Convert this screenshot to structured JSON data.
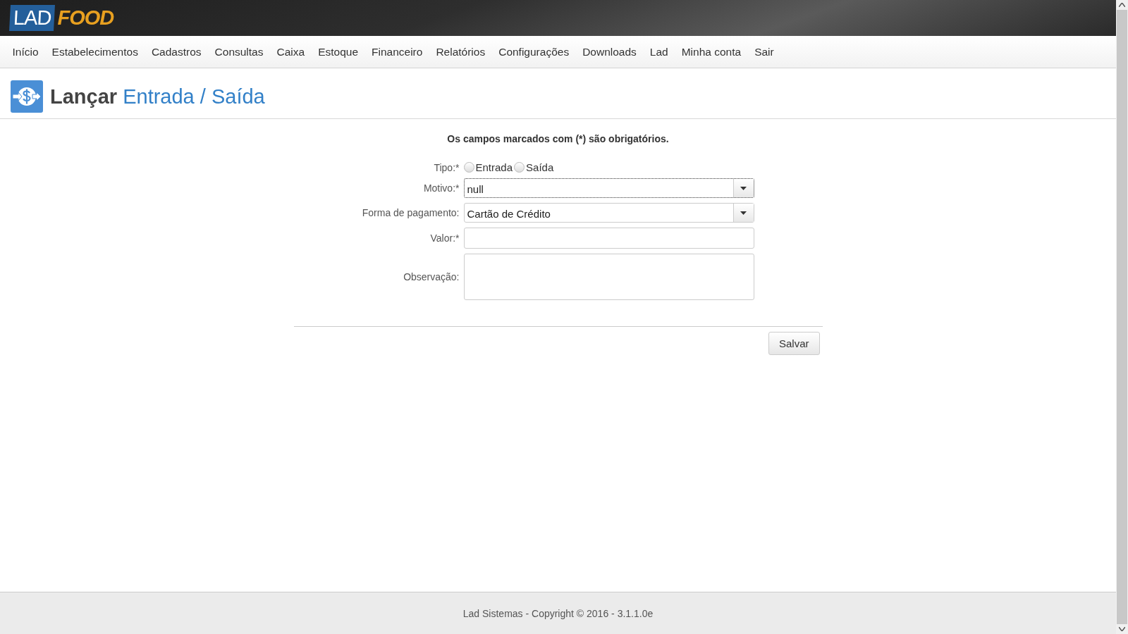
{
  "logo": {
    "primary": "LAD",
    "secondary": "FOOD"
  },
  "nav": {
    "items": [
      "Início",
      "Estabelecimentos",
      "Cadastros",
      "Consultas",
      "Caixa",
      "Estoque",
      "Financeiro",
      "Relatórios",
      "Configurações",
      "Downloads",
      "Lad",
      "Minha conta",
      "Sair"
    ]
  },
  "page_title": "**Lançar** Entrada / Saída",
  "form": {
    "notice": "Os campos marcados com (*) são obrigatórios.",
    "fields": [
      {
        "kind": "radio",
        "label": "Tipo:*",
        "options": [
          {
            "label": "Entrada",
            "selected": false
          },
          {
            "label": "Saída",
            "selected": false
          }
        ]
      },
      {
        "kind": "select",
        "label": "Motivo:*",
        "value": "null",
        "focused": true
      },
      {
        "kind": "select",
        "label": "Forma de pagamento:",
        "value": "Cartão de Crédito",
        "focused": false
      },
      {
        "kind": "text",
        "label": "Valor:*"
      },
      {
        "kind": "textarea",
        "label": "Observação:"
      }
    ],
    "submit": "Salvar"
  },
  "footer": "Lad Sistemas - Copyright © 2016 - 3.1.1.0e"
}
